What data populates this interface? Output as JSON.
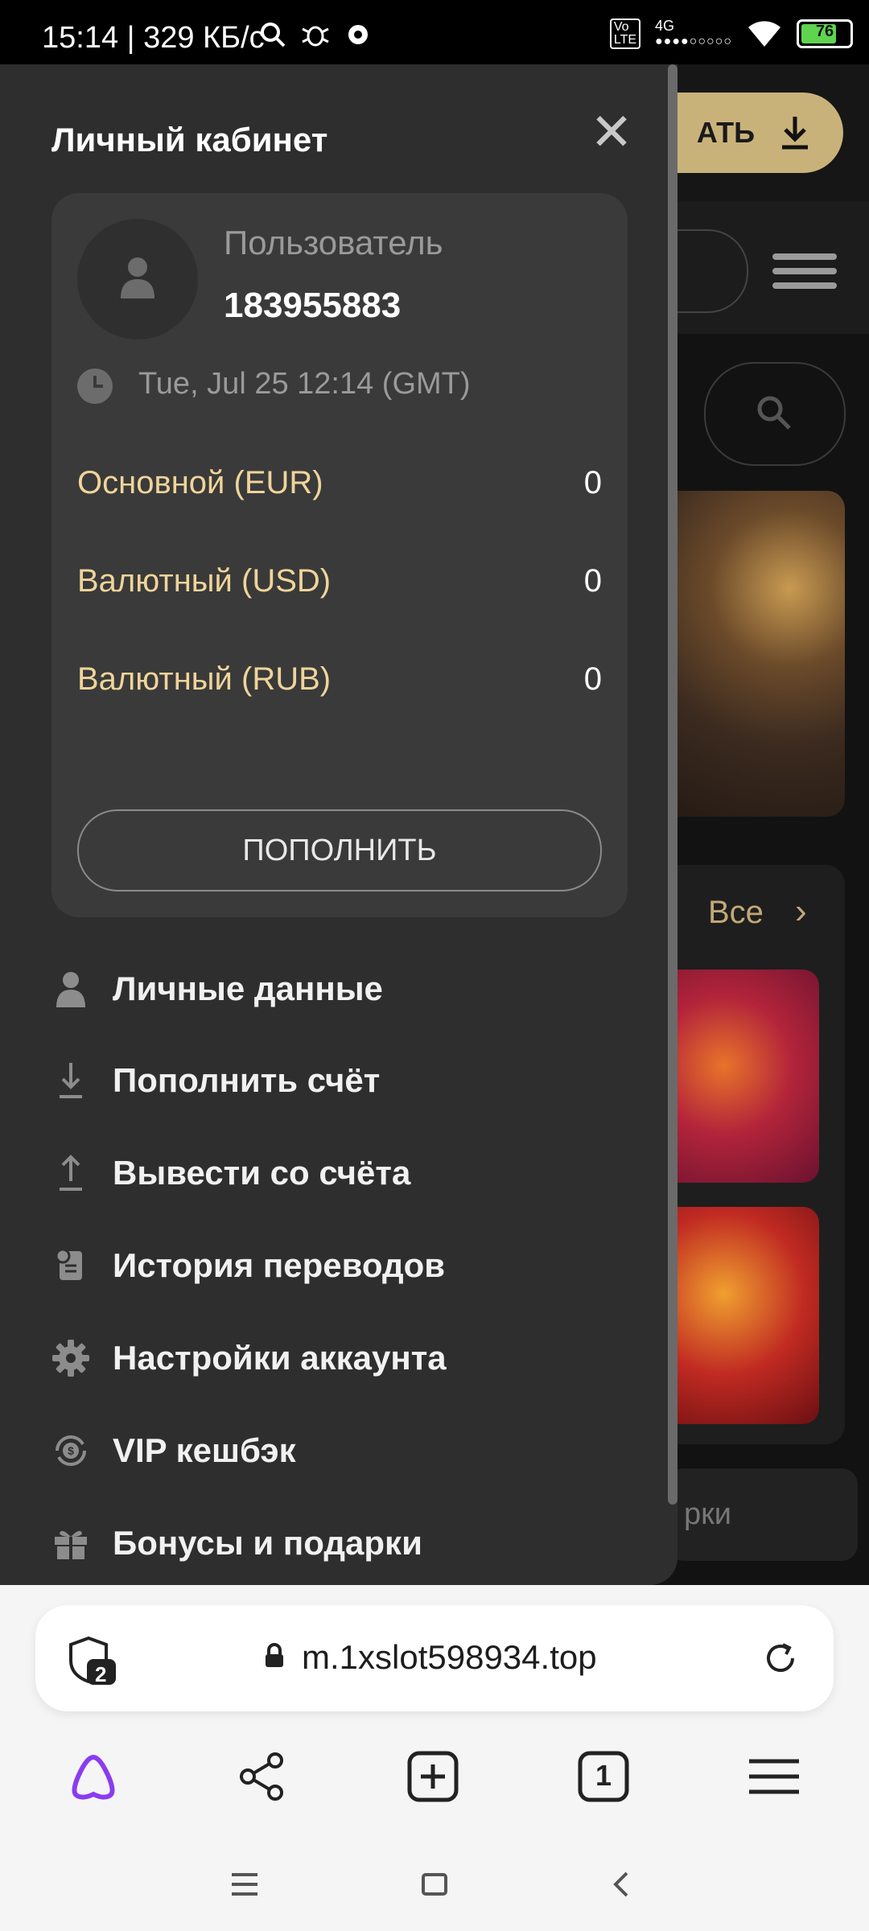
{
  "status_bar": {
    "time": "15:14 | 329 КБ/с",
    "network": "4G",
    "battery": "76",
    "battery_level": 0.76
  },
  "background_site": {
    "download_label": "АТЬ",
    "all_label": "Все",
    "bonus_fragment": "рки"
  },
  "drawer": {
    "title": "Личный кабинет",
    "close_icon": "close-icon",
    "user": {
      "label": "Пользователь",
      "id": "183955883"
    },
    "datetime": "Tue, Jul 25 12:14 (GMT)",
    "balances": [
      {
        "label": "Основной (EUR)",
        "value": "0"
      },
      {
        "label": "Валютный (USD)",
        "value": "0"
      },
      {
        "label": "Валютный (RUB)",
        "value": "0"
      }
    ],
    "topup_button": "ПОПОЛНИТЬ",
    "menu": [
      {
        "label": "Личные данные",
        "icon": "person-icon"
      },
      {
        "label": "Пополнить счёт",
        "icon": "download-icon"
      },
      {
        "label": "Вывести со счёта",
        "icon": "upload-icon"
      },
      {
        "label": "История переводов",
        "icon": "history-icon"
      },
      {
        "label": "Настройки аккаунта",
        "icon": "gear-icon"
      },
      {
        "label": "VIP кешбэк",
        "icon": "cashback-icon"
      },
      {
        "label": "Бонусы и подарки",
        "icon": "gift-icon"
      }
    ]
  },
  "browser": {
    "url": "m.1xslot598934.top",
    "tabs_badge": "2",
    "tab_count": "1"
  },
  "colors": {
    "accent": "#c9b27a",
    "balance_label": "#f0d49a",
    "drawer_bg": "#2e2e2e",
    "card_bg": "#3a3a3a"
  }
}
